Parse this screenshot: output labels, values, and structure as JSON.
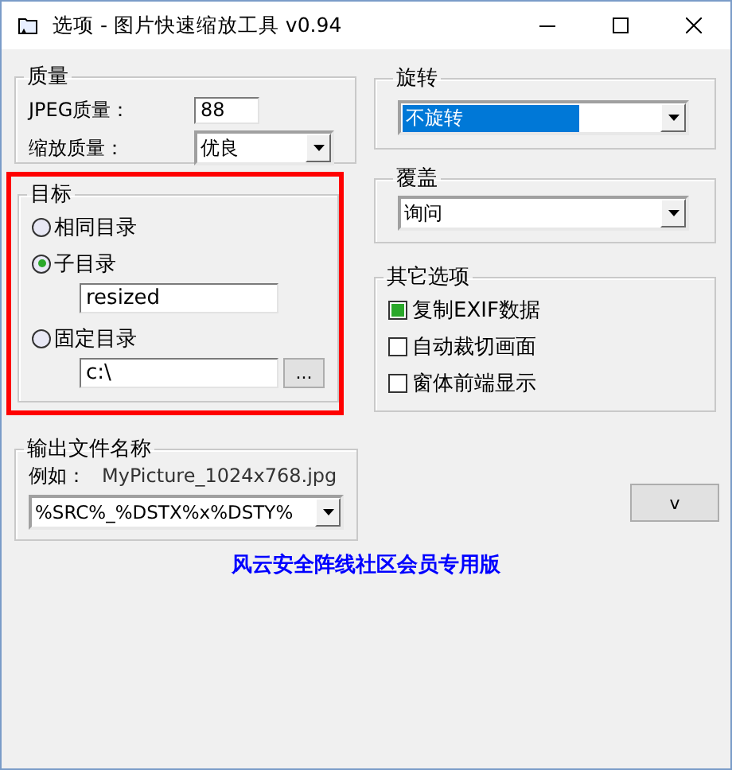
{
  "window": {
    "title": "选项 - 图片快速缩放工具 v0.94"
  },
  "quality": {
    "label": "质量",
    "jpeg_label": "JPEG质量：",
    "jpeg_value": "88",
    "scale_label": "缩放质量：",
    "scale_value": "优良"
  },
  "target": {
    "label": "目标",
    "highlighted": true,
    "options": [
      {
        "label": "相同目录",
        "selected": false
      },
      {
        "label": "子目录",
        "selected": true,
        "field": "resized"
      },
      {
        "label": "固定目录",
        "selected": false,
        "field": "c:\\",
        "browse": "..."
      }
    ]
  },
  "output": {
    "label": "输出文件名称",
    "example_label": "例如：",
    "example": "MyPicture_1024x768.jpg",
    "pattern": "%SRC%_%DSTX%x%DSTY%"
  },
  "rotate": {
    "label": "旋转",
    "value": "不旋转",
    "value_selected": true
  },
  "overwrite": {
    "label": "覆盖",
    "value": "询问"
  },
  "other": {
    "label": "其它选项",
    "options": [
      {
        "label": "复制EXIF数据",
        "checked": true
      },
      {
        "label": "自动裁切画面",
        "checked": false
      },
      {
        "label": "窗体前端显示",
        "checked": false
      }
    ]
  },
  "button": "v",
  "footer": "风云安全阵线社区会员专用版"
}
